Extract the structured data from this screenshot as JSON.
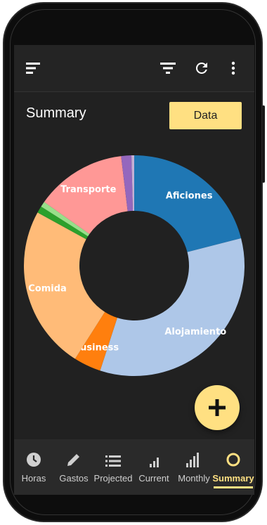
{
  "summary": {
    "title": "Summary",
    "data_button": "Data"
  },
  "fab": {
    "icon": "plus-icon"
  },
  "colors": {
    "accent": "#ffe082",
    "background": "#212121"
  },
  "chart_data": {
    "type": "pie",
    "style": "donut",
    "slices": [
      {
        "label": "Aficiones",
        "value": 21.0,
        "color": "#1f77b4",
        "show_label": true
      },
      {
        "label": "Alojamiento",
        "value": 34.0,
        "color": "#aec7e8",
        "show_label": true
      },
      {
        "label": "Business",
        "value": 4.0,
        "color": "#ff7f0e",
        "show_label": true
      },
      {
        "label": "Comida",
        "value": 24.0,
        "color": "#ffbb78",
        "show_label": true
      },
      {
        "label": "",
        "value": 1.0,
        "color": "#2ca02c",
        "show_label": false
      },
      {
        "label": "",
        "value": 0.8,
        "color": "#98df8a",
        "show_label": false
      },
      {
        "label": "Transporte",
        "value": 13.3,
        "color": "#ff9896",
        "show_label": true
      },
      {
        "label": "",
        "value": 1.5,
        "color": "#9467bd",
        "show_label": false
      },
      {
        "label": "",
        "value": 0.4,
        "color": "#c5b0d5",
        "show_label": false
      }
    ]
  },
  "nav": {
    "items": [
      {
        "label": "Horas",
        "icon": "clock-icon"
      },
      {
        "label": "Gastos",
        "icon": "pencil-icon"
      },
      {
        "label": "Projected",
        "icon": "list-icon"
      },
      {
        "label": "Current",
        "icon": "bar-small-icon"
      },
      {
        "label": "Monthly",
        "icon": "bar-large-icon"
      },
      {
        "label": "Summary",
        "icon": "donut-icon",
        "active": true
      }
    ]
  }
}
